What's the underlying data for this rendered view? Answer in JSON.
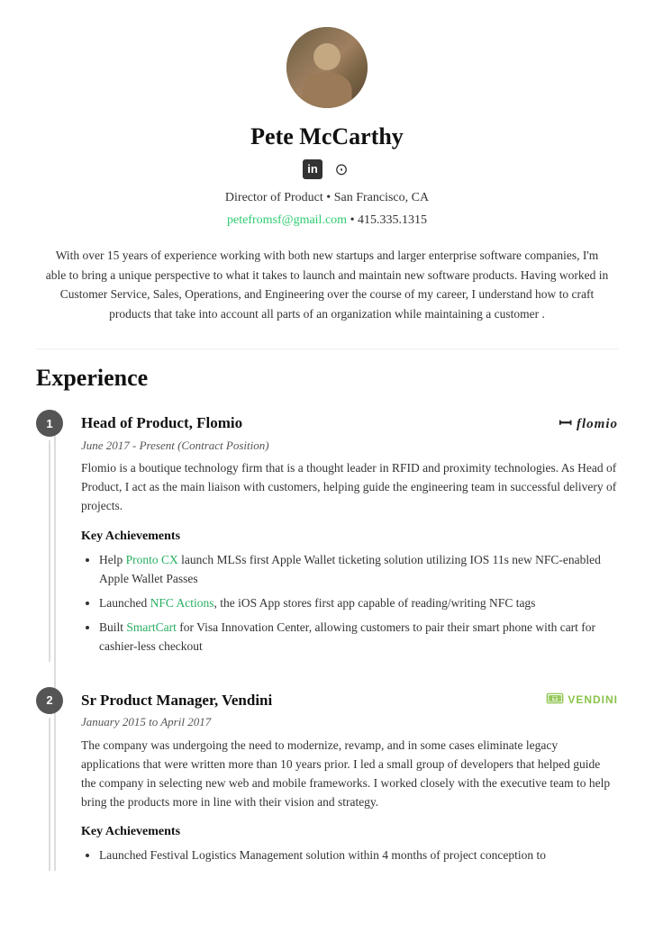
{
  "header": {
    "name": "Pete McCarthy",
    "title": "Director of Product",
    "location": "San Francisco, CA",
    "email": "petefromsf@gmail.com",
    "phone": "415.335.1315",
    "linkedin_label": "in",
    "github_label": "⊙",
    "title_separator": "•"
  },
  "summary": {
    "text": "With over 15 years of experience working with both new startups and larger enterprise software companies, I'm able to bring a unique perspective to what it takes to launch and maintain new software products. Having worked in Customer Service, Sales, Operations, and Engineering over the course of my career, I understand how to craft products that take into account all parts of an organization while maintaining a customer ."
  },
  "experience": {
    "section_title": "Experience",
    "jobs": [
      {
        "number": "1",
        "title": "Head of Product, Flomio",
        "date": "June 2017 - Present (Contract Position)",
        "description": "Flomio is a boutique technology firm that is a thought leader in RFID and proximity technologies. As Head of Product, I act as the main liaison with customers, helping guide the engineering team in successful delivery of projects.",
        "achievements_title": "Key Achievements",
        "achievements": [
          "Help Pronto CX launch MLSs first Apple Wallet ticketing solution utilizing IOS 11s new NFC-enabled Apple Wallet Passes",
          "Launched NFC Actions, the iOS App stores first app capable of reading/writing NFC tags",
          "Built SmartCart for Visa Innovation Center, allowing customers to pair their smart phone with cart for cashier-less checkout"
        ],
        "highlights": [
          {
            "text": "Pronto CX",
            "position": "achievement_0_start"
          },
          {
            "text": "NFC Actions",
            "position": "achievement_1_start"
          },
          {
            "text": "SmartCart",
            "position": "achievement_2_start"
          }
        ],
        "logo_type": "flomio"
      },
      {
        "number": "2",
        "title": "Sr Product Manager, Vendini",
        "date": "January 2015 to April 2017",
        "description": "The company was undergoing the need to modernize, revamp, and in some cases eliminate legacy applications that were written more than 10 years prior. I led a small group of developers that helped guide the company in selecting new web and mobile frameworks. I worked closely with the executive team to help bring the products more in line with their vision and strategy.",
        "achievements_title": "Key Achievements",
        "achievements": [
          "Launched Festival Logistics Management solution within 4 months of project conception to"
        ],
        "logo_type": "vendini"
      }
    ]
  }
}
